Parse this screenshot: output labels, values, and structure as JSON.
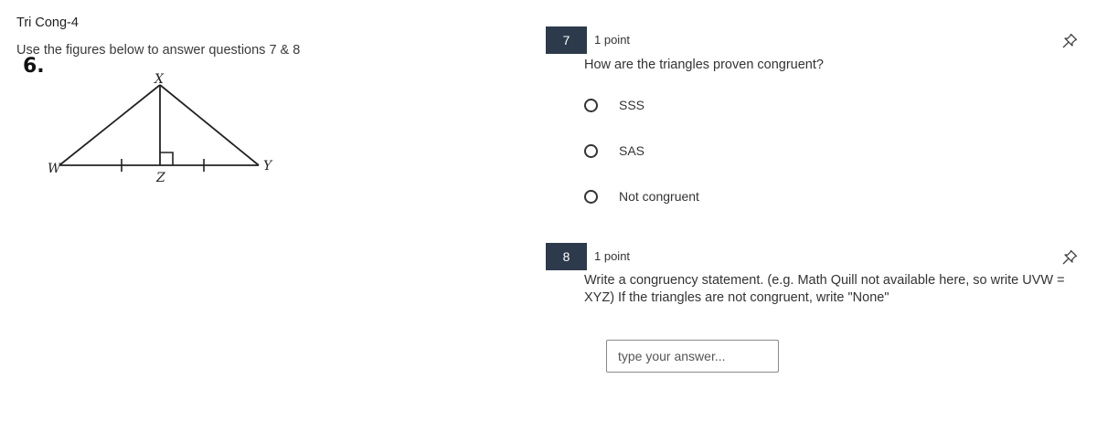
{
  "doc": {
    "title": "Tri Cong-4",
    "instructions": "Use the figures below to answer questions 7 & 8",
    "figure_number": "6.",
    "figure_labels": {
      "x": "X",
      "w": "W",
      "z": "Z",
      "y": "Y"
    }
  },
  "questions": [
    {
      "number": "7",
      "points": "1 point",
      "text": "How are the triangles proven congruent?",
      "options": [
        "SSS",
        "SAS",
        "Not congruent"
      ]
    },
    {
      "number": "8",
      "points": "1 point",
      "text_line1": "Write a congruency statement. (e.g. Math Quill not available here, so write UVW =",
      "text_line2": "XYZ)  If the triangles are not congruent, write \"None\"",
      "answer_value": "",
      "answer_placeholder": "type your answer..."
    }
  ],
  "icons": {
    "pin": "pushpin-icon",
    "radio": "radio-empty-icon"
  },
  "colors": {
    "question_badge_bg": "#2c3a4b",
    "question_badge_text": "#ffffff"
  }
}
